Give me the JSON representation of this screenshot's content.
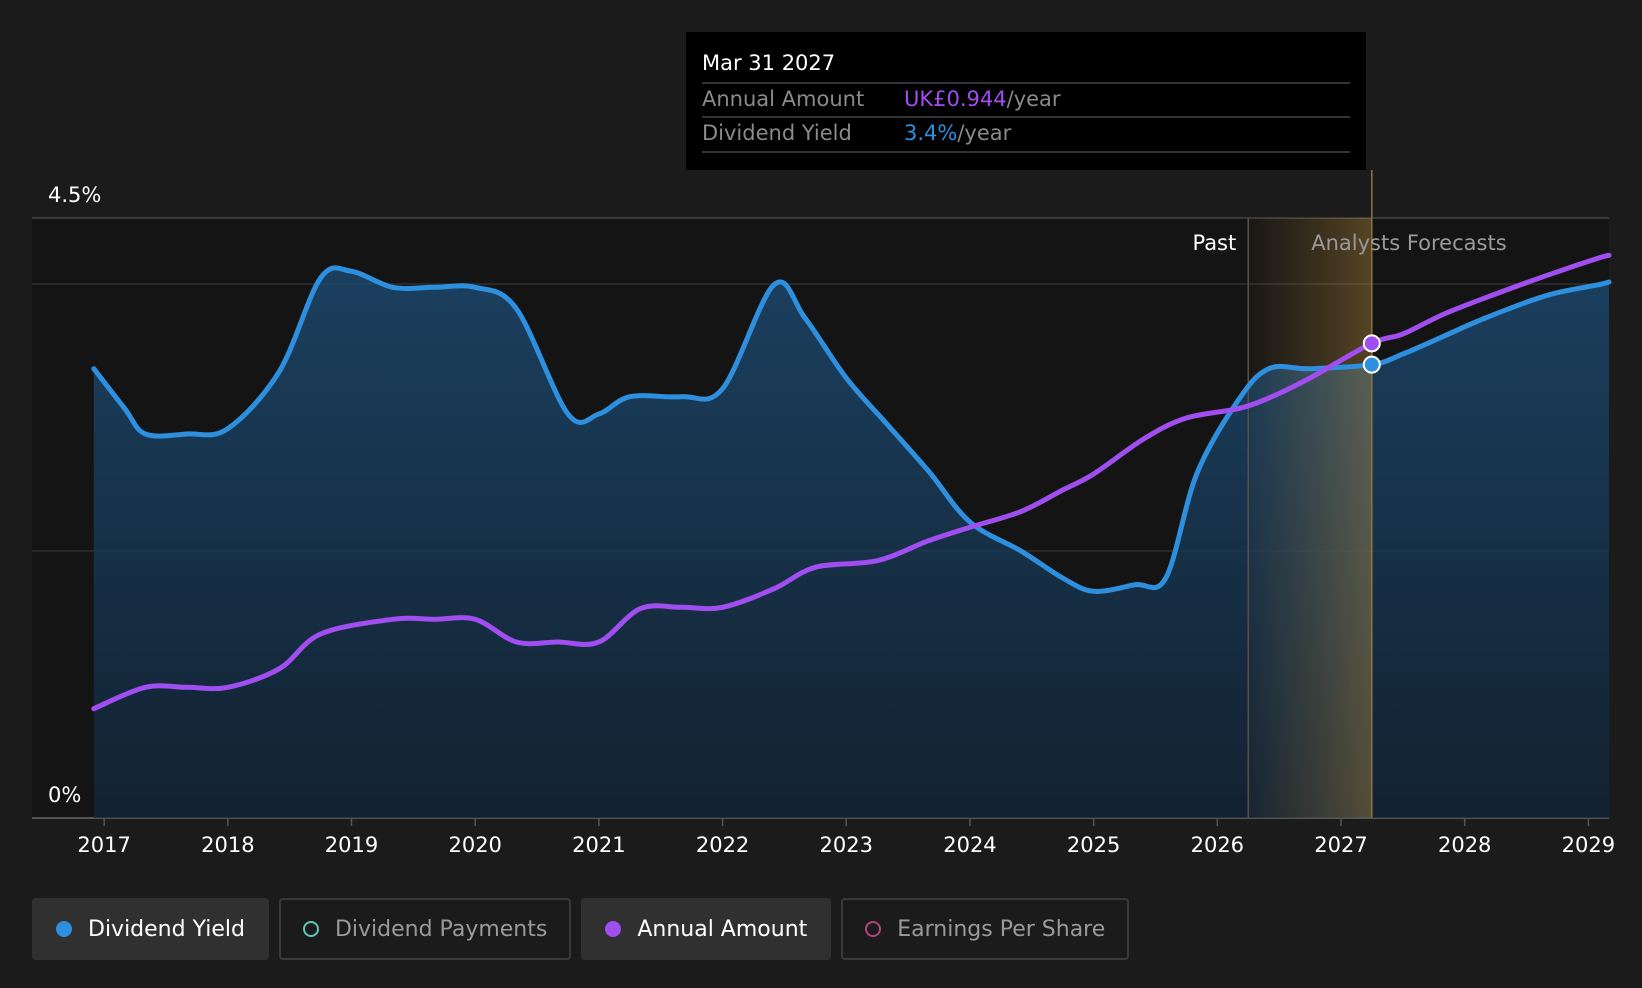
{
  "chart_data": {
    "type": "line",
    "x_axis": {
      "ticks": [
        "2017",
        "2018",
        "2019",
        "2020",
        "2021",
        "2022",
        "2023",
        "2024",
        "2025",
        "2026",
        "2027",
        "2028",
        "2029"
      ],
      "range": [
        "2016-06",
        "2029-03"
      ]
    },
    "y_axis": {
      "range": [
        0,
        4.5
      ],
      "tick_labels": [
        "0%",
        "4.5%"
      ]
    },
    "grid": true,
    "regions": {
      "past_label": "Past",
      "forecast_label": "Analysts Forecasts",
      "past_end": "2026-04-01"
    },
    "series": [
      {
        "name": "Dividend Yield",
        "color": "#2d8fdd",
        "unit": "%",
        "points": [
          [
            "2016-12-01",
            3.37
          ],
          [
            "2017-03-01",
            3.07
          ],
          [
            "2017-05-01",
            2.88
          ],
          [
            "2017-09-01",
            2.88
          ],
          [
            "2018-01-01",
            2.92
          ],
          [
            "2018-06-01",
            3.35
          ],
          [
            "2018-10-01",
            4.05
          ],
          [
            "2019-01-01",
            4.1
          ],
          [
            "2019-05-01",
            3.98
          ],
          [
            "2019-09-01",
            3.98
          ],
          [
            "2020-01-01",
            3.98
          ],
          [
            "2020-05-01",
            3.82
          ],
          [
            "2020-10-01",
            3.03
          ],
          [
            "2021-01-01",
            3.03
          ],
          [
            "2021-04-01",
            3.16
          ],
          [
            "2021-09-01",
            3.16
          ],
          [
            "2022-01-01",
            3.22
          ],
          [
            "2022-06-01",
            4.0
          ],
          [
            "2022-09-01",
            3.75
          ],
          [
            "2023-01-01",
            3.3
          ],
          [
            "2023-05-01",
            2.95
          ],
          [
            "2023-09-01",
            2.6
          ],
          [
            "2024-01-01",
            2.22
          ],
          [
            "2024-06-01",
            2.0
          ],
          [
            "2024-10-01",
            1.8
          ],
          [
            "2025-01-01",
            1.7
          ],
          [
            "2025-05-01",
            1.75
          ],
          [
            "2025-08-01",
            1.8
          ],
          [
            "2025-11-01",
            2.58
          ],
          [
            "2026-03-01",
            3.13
          ],
          [
            "2026-06-01",
            3.37
          ],
          [
            "2026-10-01",
            3.37
          ],
          [
            "2027-03-31",
            3.4
          ],
          [
            "2027-07-01",
            3.48
          ],
          [
            "2027-10-01",
            3.58
          ],
          [
            "2028-03-01",
            3.75
          ],
          [
            "2028-09-01",
            3.92
          ],
          [
            "2029-02-01",
            4.0
          ]
        ]
      },
      {
        "name": "Annual Amount",
        "color": "#a04ef0",
        "unit": "UK£",
        "points": [
          [
            "2016-12-01",
            0.82
          ],
          [
            "2017-05-01",
            0.98
          ],
          [
            "2017-09-01",
            0.98
          ],
          [
            "2018-01-01",
            0.98
          ],
          [
            "2018-06-01",
            1.12
          ],
          [
            "2018-10-01",
            1.38
          ],
          [
            "2019-05-01",
            1.49
          ],
          [
            "2019-09-01",
            1.49
          ],
          [
            "2020-01-01",
            1.49
          ],
          [
            "2020-05-01",
            1.32
          ],
          [
            "2020-09-01",
            1.32
          ],
          [
            "2021-01-01",
            1.32
          ],
          [
            "2021-05-01",
            1.57
          ],
          [
            "2021-09-01",
            1.58
          ],
          [
            "2022-01-01",
            1.58
          ],
          [
            "2022-06-01",
            1.72
          ],
          [
            "2022-10-01",
            1.88
          ],
          [
            "2023-04-01",
            1.93
          ],
          [
            "2023-09-01",
            2.08
          ],
          [
            "2024-01-01",
            2.18
          ],
          [
            "2024-06-01",
            2.3
          ],
          [
            "2024-10-01",
            2.46
          ],
          [
            "2025-01-01",
            2.58
          ],
          [
            "2025-06-01",
            2.85
          ],
          [
            "2025-10-01",
            3.0
          ],
          [
            "2026-03-01",
            3.07
          ],
          [
            "2026-06-01",
            3.15
          ],
          [
            "2026-10-01",
            3.3
          ],
          [
            "2027-03-31",
            3.56
          ],
          [
            "2027-07-01",
            3.63
          ],
          [
            "2027-11-01",
            3.78
          ],
          [
            "2028-04-01",
            3.93
          ],
          [
            "2028-09-01",
            4.07
          ],
          [
            "2029-02-01",
            4.2
          ]
        ]
      }
    ],
    "hover": {
      "date": "2027-03-31"
    }
  },
  "tooltip": {
    "date": "Mar 31 2027",
    "rows": [
      {
        "label": "Annual Amount",
        "value": "UK£0.944",
        "suffix": "/year",
        "color": "#a04ef0"
      },
      {
        "label": "Dividend Yield",
        "value": "3.4%",
        "suffix": "/year",
        "color": "#2d8fdd"
      }
    ]
  },
  "legend": [
    {
      "label": "Dividend Yield",
      "color": "#2d8fdd",
      "active": true
    },
    {
      "label": "Dividend Payments",
      "color": "#5fc7b8",
      "active": false
    },
    {
      "label": "Annual Amount",
      "color": "#a04ef0",
      "active": true
    },
    {
      "label": "Earnings Per Share",
      "color": "#b0457e",
      "active": false
    }
  ]
}
